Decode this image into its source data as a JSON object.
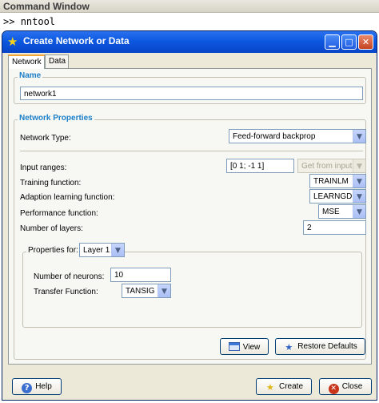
{
  "command_window": {
    "title": "Command Window",
    "prompt": ">> ",
    "command": "nntool"
  },
  "dialog": {
    "title": "Create Network or Data",
    "controls": {
      "minimize": "▁",
      "maximize": "□",
      "close": "✕"
    },
    "tabs": [
      {
        "label": "Network"
      },
      {
        "label": "Data"
      }
    ],
    "name_section": {
      "legend": "Name",
      "value": "network1"
    },
    "properties": {
      "legend": "Network Properties",
      "network_type": {
        "label": "Network Type:",
        "value": "Feed-forward backprop"
      },
      "input_ranges": {
        "label": "Input ranges:",
        "value": "[0 1; -1 1]",
        "get_from_input": "Get from input:"
      },
      "training_function": {
        "label": "Training function:",
        "value": "TRAINLM"
      },
      "adaption_function": {
        "label": "Adaption learning function:",
        "value": "LEARNGDM"
      },
      "performance_function": {
        "label": "Performance function:",
        "value": "MSE"
      },
      "number_of_layers": {
        "label": "Number of layers:",
        "value": "2"
      },
      "layer_props": {
        "label": "Properties for:",
        "layer": "Layer 1",
        "neurons": {
          "label": "Number of neurons:",
          "value": "10"
        },
        "transfer": {
          "label": "Transfer Function:",
          "value": "TANSIG"
        }
      }
    },
    "buttons": {
      "view": "View",
      "restore_defaults": "Restore Defaults",
      "help": "Help",
      "create": "Create",
      "close": "Close"
    },
    "icons": {
      "title": "star-icon",
      "view": "window-icon",
      "restore": "star-icon",
      "help": "help-icon",
      "create": "star-icon",
      "close": "close-icon"
    }
  }
}
